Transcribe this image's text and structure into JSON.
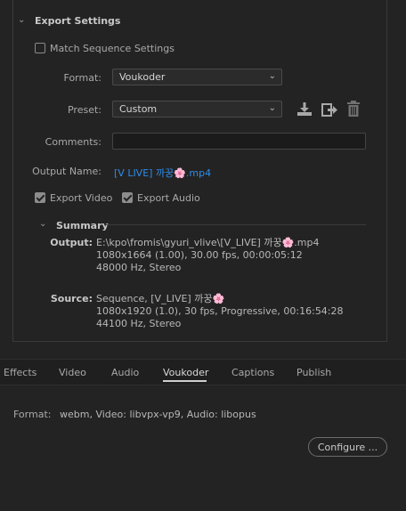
{
  "export_settings": {
    "title": "Export Settings",
    "match_sequence_label": "Match Sequence Settings",
    "match_sequence_checked": false,
    "format_label": "Format:",
    "format_value": "Voukoder",
    "preset_label": "Preset:",
    "preset_value": "Custom",
    "comments_label": "Comments:",
    "comments_value": "",
    "output_name_label": "Output Name:",
    "output_name_value": "[V LIVE] 까꿍🌸.mp4",
    "export_video_label": "Export Video",
    "export_video_checked": true,
    "export_audio_label": "Export Audio",
    "export_audio_checked": true
  },
  "summary": {
    "title": "Summary",
    "output_key": "Output:",
    "output_lines": [
      "E:\\kpo\\fromis\\gyuri_vlive\\[V_LIVE] 까꿍🌸.mp4",
      "1080x1664 (1.00), 30.00 fps, 00:00:05:12",
      "48000 Hz, Stereo"
    ],
    "source_key": "Source:",
    "source_lines": [
      "Sequence, [V_LIVE] 까꿍🌸",
      "1080x1920 (1.0), 30 fps, Progressive, 00:16:54:28",
      "44100 Hz, Stereo"
    ]
  },
  "tabs": [
    "Effects",
    "Video",
    "Audio",
    "Voukoder",
    "Captions",
    "Publish"
  ],
  "active_tab": "Voukoder",
  "voukoder": {
    "format_label": "Format:",
    "format_value": "webm, Video: libvpx-vp9, Audio: libopus",
    "configure_label": "Configure ..."
  },
  "icons": {
    "collapse": "chevron-down-icon",
    "save_preset": "download-icon",
    "import_preset": "import-icon",
    "delete_preset": "trash-icon"
  },
  "colors": {
    "background": "#232323",
    "link": "#2d8ceb"
  }
}
